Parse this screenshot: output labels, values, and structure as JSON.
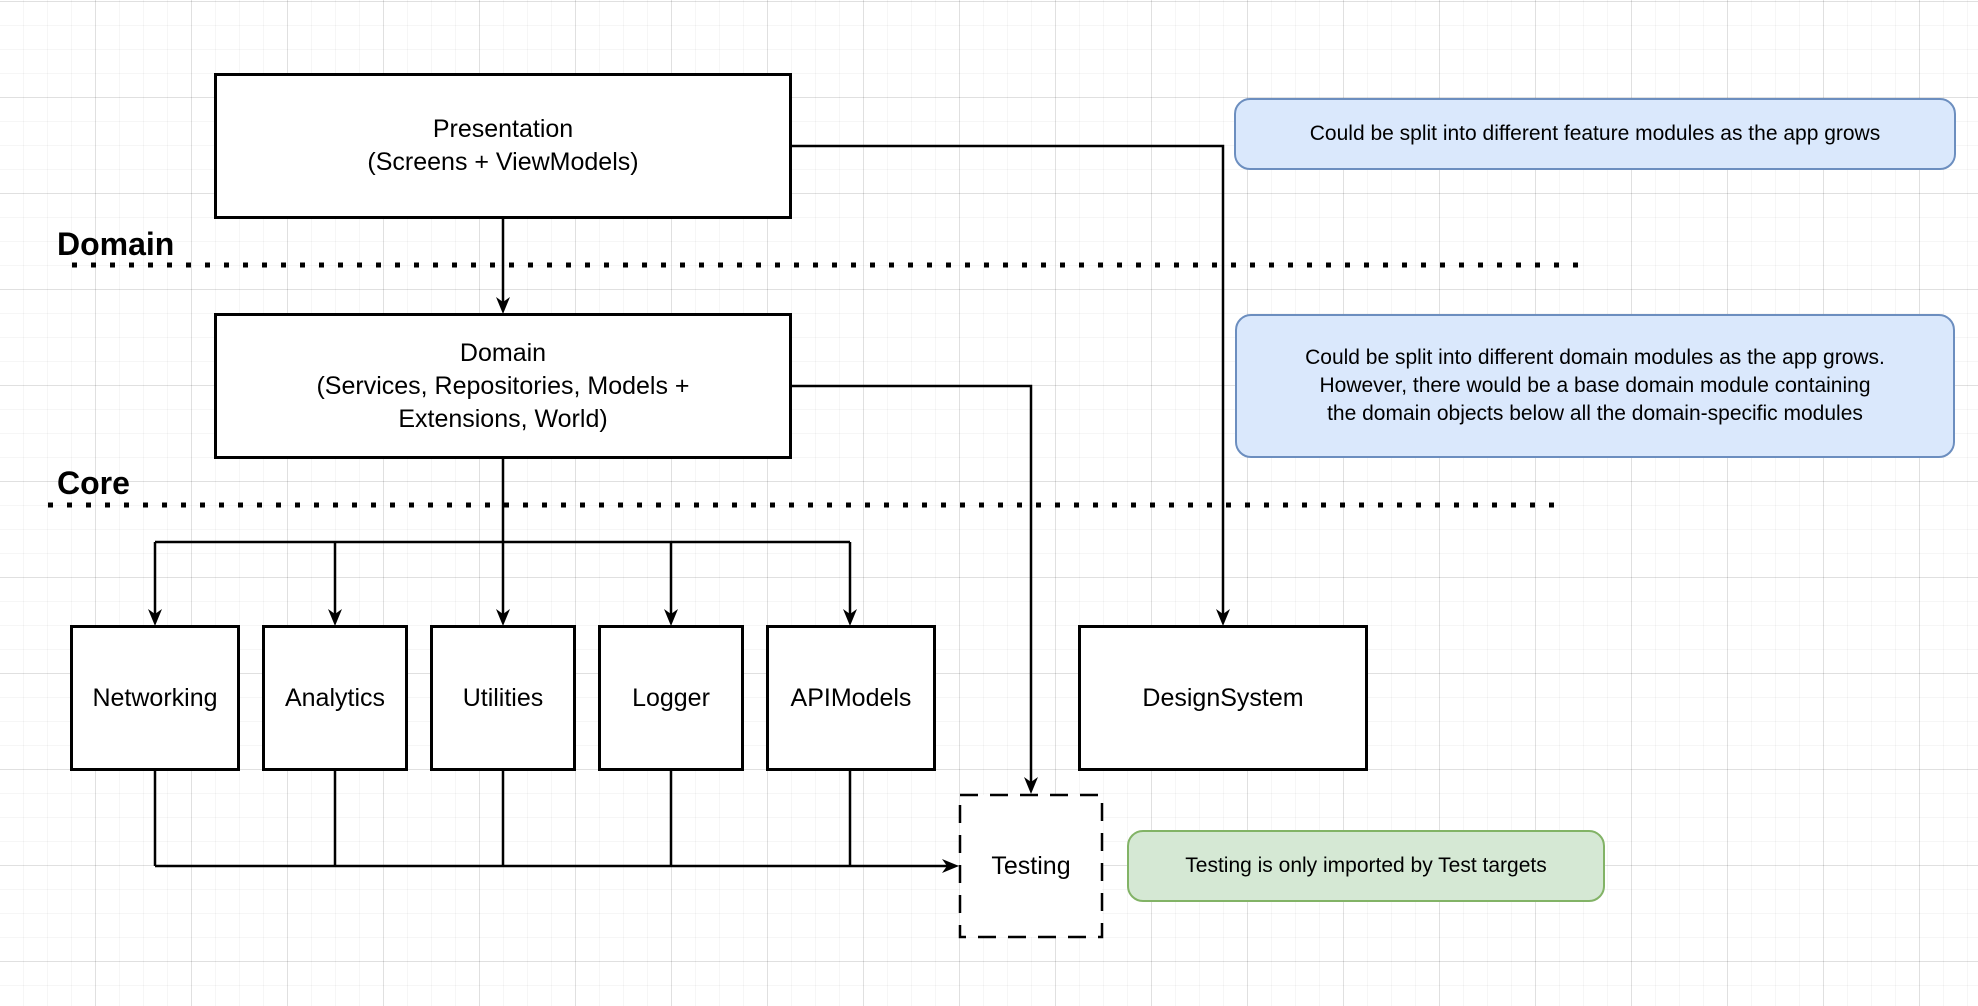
{
  "layers": {
    "domain": {
      "label": "Domain"
    },
    "core": {
      "label": "Core"
    }
  },
  "nodes": {
    "presentation": {
      "label": "Presentation\n(Screens + ViewModels)"
    },
    "domain": {
      "label": "Domain\n(Services, Repositories, Models +\nExtensions, World)"
    },
    "networking": {
      "label": "Networking"
    },
    "analytics": {
      "label": "Analytics"
    },
    "utilities": {
      "label": "Utilities"
    },
    "logger": {
      "label": "Logger"
    },
    "apimodels": {
      "label": "APIModels"
    },
    "designsystem": {
      "label": "DesignSystem"
    },
    "testing": {
      "label": "Testing",
      "border_style": "dashed"
    }
  },
  "notes": {
    "presentation_note": {
      "text": "Could be split into different feature modules as the app grows",
      "fill": "#dae8fc",
      "stroke": "#6c8ebf"
    },
    "domain_note": {
      "text": "Could be split into different domain modules as the app grows.\nHowever, there would be a base domain module containing\n the domain objects below all the domain-specific modules",
      "fill": "#dae8fc",
      "stroke": "#6c8ebf"
    },
    "testing_note": {
      "text": "Testing is only imported by Test targets",
      "fill": "#d5e8d4",
      "stroke": "#82b366"
    }
  },
  "edges": [
    {
      "from": "presentation",
      "to": "domain"
    },
    {
      "from": "presentation",
      "to": "designsystem"
    },
    {
      "from": "domain",
      "to": "networking"
    },
    {
      "from": "domain",
      "to": "analytics"
    },
    {
      "from": "domain",
      "to": "utilities"
    },
    {
      "from": "domain",
      "to": "logger"
    },
    {
      "from": "domain",
      "to": "apimodels"
    },
    {
      "from": "domain",
      "to": "testing"
    },
    {
      "from": "networking",
      "to": "testing"
    },
    {
      "from": "analytics",
      "to": "testing"
    },
    {
      "from": "utilities",
      "to": "testing"
    },
    {
      "from": "logger",
      "to": "testing"
    },
    {
      "from": "apimodels",
      "to": "testing"
    }
  ]
}
